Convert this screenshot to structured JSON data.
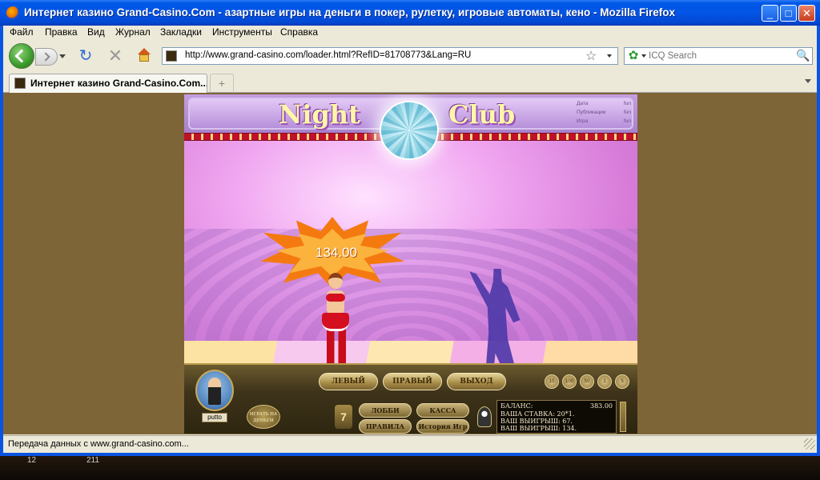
{
  "window": {
    "title": "Интернет казино Grand-Casino.Com - азартные игры на деньги в покер, рулетку, игровые автоматы, кено - Mozilla Firefox",
    "minimize_glyph": "_",
    "maximize_glyph": "□",
    "close_glyph": "✕"
  },
  "menu": {
    "file": "Файл",
    "edit": "Правка",
    "view": "Вид",
    "history": "Журнал",
    "bookmarks": "Закладки",
    "tools": "Инструменты",
    "help": "Справка"
  },
  "nav": {
    "url": "http://www.grand-casino.com/loader.html?RefID=81708773&Lang=RU",
    "search_placeholder": "ICQ Search",
    "reload_glyph": "↻",
    "stop_glyph": "✕",
    "bookmark_glyph": "☆",
    "search_go_glyph": "🔍",
    "search_engine_glyph": "✿"
  },
  "tabs": [
    {
      "label": "Интернет казино Grand-Casino.Com...",
      "active": true
    }
  ],
  "new_tab_glyph": "+",
  "game": {
    "logo_left": "Night",
    "logo_right": "Club",
    "info": [
      {
        "label": "Дата",
        "value": "fun"
      },
      {
        "label": "Публикации",
        "value": "fun"
      },
      {
        "label": "Игра",
        "value": "fun"
      }
    ],
    "bet_display": "134.00",
    "buttons": {
      "left": "ЛЕВЫЙ",
      "right": "ПРАВЫЙ",
      "exit": "ВЫХОД",
      "lobby": "ЛОББИ",
      "cashier": "КАССА",
      "rules": "ПРАВИЛА",
      "history": "История Игр"
    },
    "chips": [
      "10",
      "100",
      "50",
      "1",
      "5"
    ],
    "username": "putto",
    "play_money": "ИГРАТЬ НА ДЕНЬГИ",
    "sevens_logo": "7",
    "balance_label": "БАЛАНС:",
    "balance_value": "383.00",
    "your_bet": "ВАША СТАВКА: 20*1.",
    "your_win_1": "ВАШ ВЫИГРЫШ: 67.",
    "your_win_2": "ВАШ ВЫИГРЫШ: 134."
  },
  "status": {
    "text": "Передача данных с www.grand-casino.com..."
  },
  "desktop": {
    "left_number": "12",
    "right_number": "211"
  },
  "colors": {
    "titlebar": "#0058e6",
    "chrome": "#ece9d8",
    "content_bg": "#7e6537",
    "bet_burst": "#f47a10"
  }
}
